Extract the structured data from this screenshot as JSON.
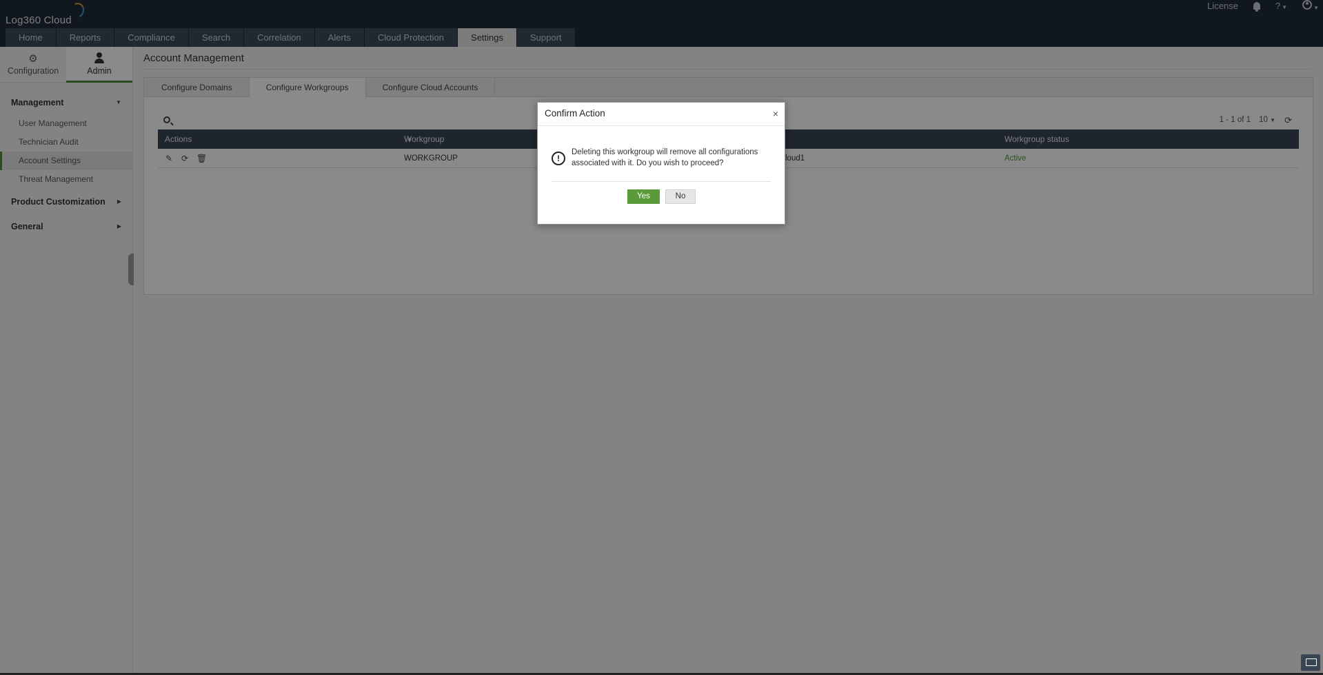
{
  "app": {
    "logo_text": "Log360 Cloud",
    "license_label": "License",
    "help_label": "?"
  },
  "nav": {
    "tabs": [
      "Home",
      "Reports",
      "Compliance",
      "Search",
      "Correlation",
      "Alerts",
      "Cloud Protection",
      "Settings",
      "Support"
    ],
    "active": "Settings"
  },
  "sidebar": {
    "tabs": [
      {
        "label": "Configuration",
        "icon": "gear-icon"
      },
      {
        "label": "Admin",
        "icon": "user-icon",
        "active": true
      }
    ],
    "sections": [
      {
        "label": "Management",
        "expanded": true,
        "items": [
          "User Management",
          "Technician Audit",
          "Account Settings",
          "Threat Management"
        ],
        "active_item": "Account Settings"
      },
      {
        "label": "Product Customization",
        "expanded": false
      },
      {
        "label": "General",
        "expanded": false
      }
    ]
  },
  "main": {
    "title": "Account Management",
    "subtabs": [
      "Configure Domains",
      "Configure Workgroups",
      "Configure Cloud Accounts"
    ],
    "active_subtab": "Configure Workgroups",
    "pager": "1 - 1 of 1",
    "page_size": "10",
    "columns": [
      "Actions",
      "Workgroup name",
      "Workgroup status"
    ],
    "rows": [
      {
        "name": "WORKGROUP",
        "partial": "loud1",
        "status": "Active"
      }
    ]
  },
  "modal": {
    "title": "Confirm Action",
    "message": "Deleting this workgroup will remove all configurations associated with it. Do you wish to proceed?",
    "yes_label": "Yes",
    "no_label": "No",
    "close_glyph": "×"
  },
  "colors": {
    "topbar": "#1f2b3a",
    "accent_green": "#5a9a38",
    "grid_header": "#3a4554",
    "status_active": "#4f9a2e"
  }
}
